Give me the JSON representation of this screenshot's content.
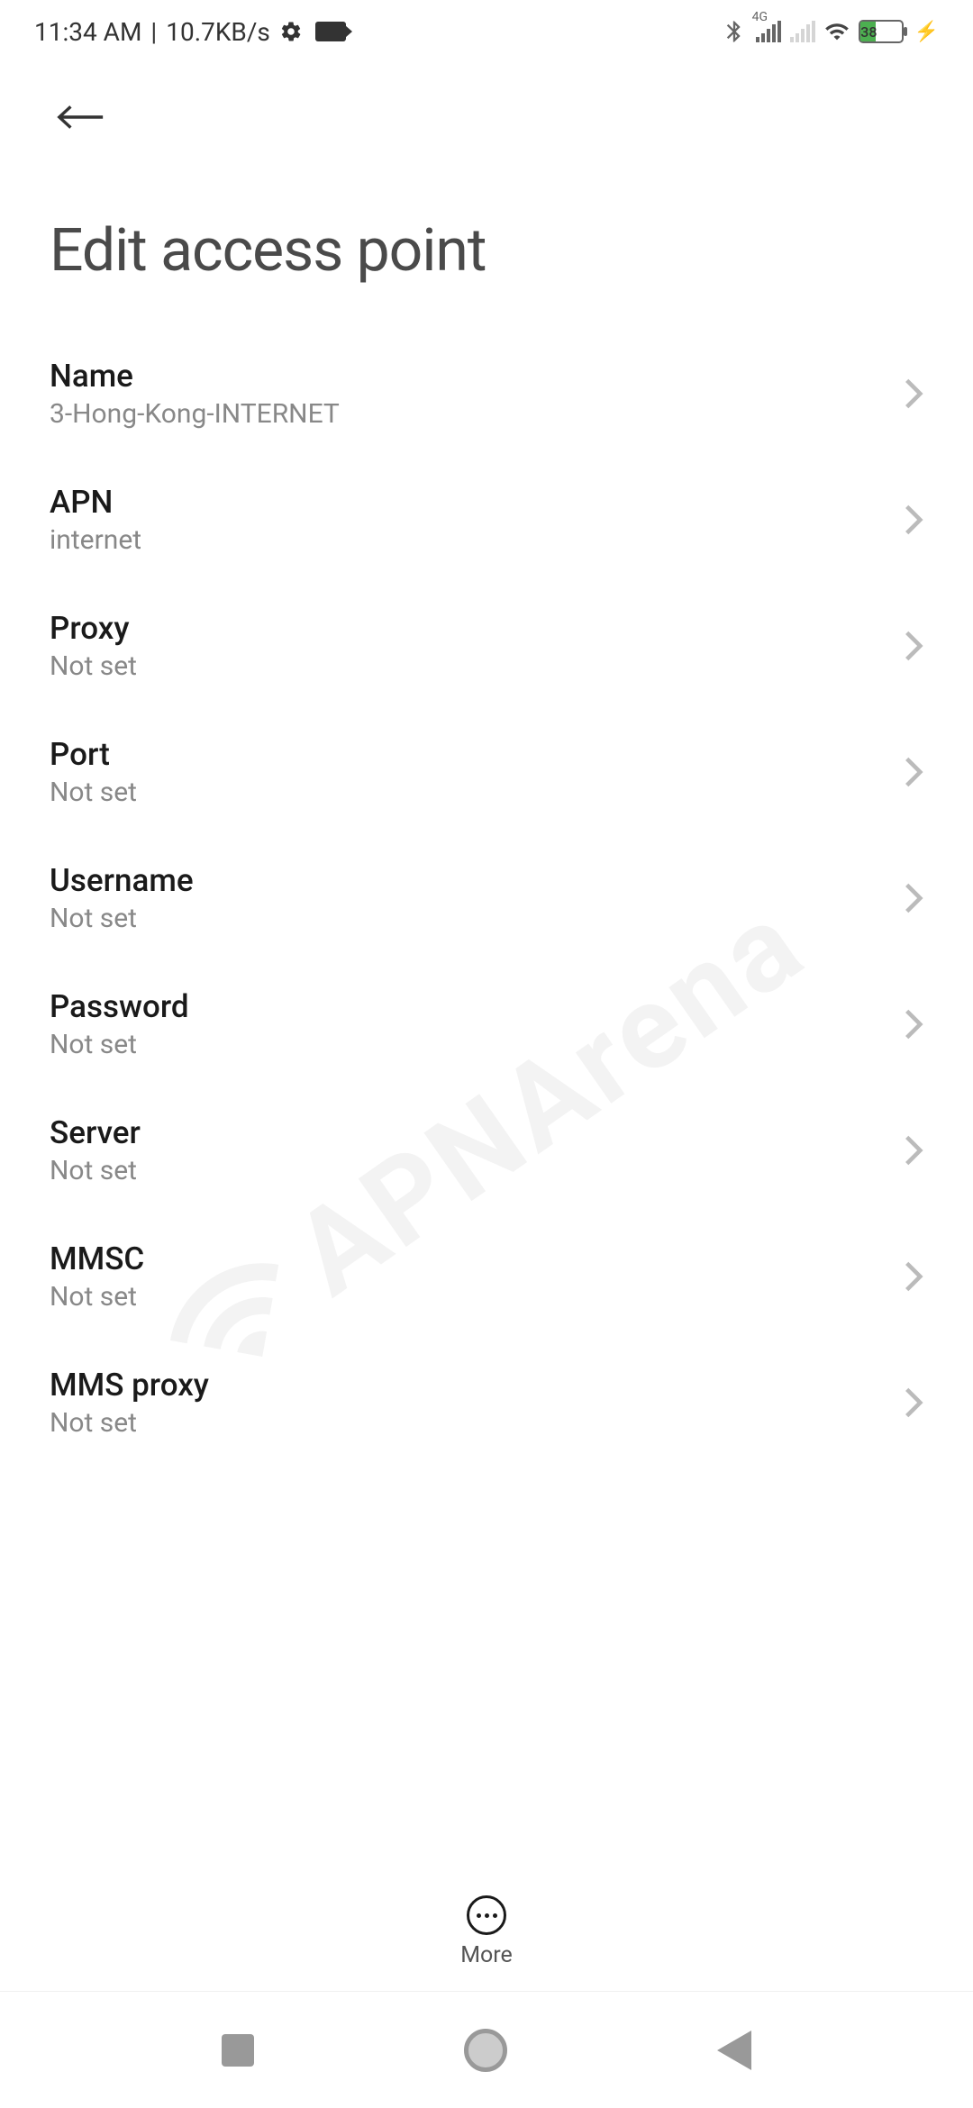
{
  "status": {
    "time": "11:34 AM",
    "data_speed": "10.7KB/s",
    "network_label": "4G",
    "battery_pct": "38"
  },
  "page_title": "Edit access point",
  "items": [
    {
      "label": "Name",
      "value": "3-Hong-Kong-INTERNET"
    },
    {
      "label": "APN",
      "value": "internet"
    },
    {
      "label": "Proxy",
      "value": "Not set"
    },
    {
      "label": "Port",
      "value": "Not set"
    },
    {
      "label": "Username",
      "value": "Not set"
    },
    {
      "label": "Password",
      "value": "Not set"
    },
    {
      "label": "Server",
      "value": "Not set"
    },
    {
      "label": "MMSC",
      "value": "Not set"
    },
    {
      "label": "MMS proxy",
      "value": "Not set"
    }
  ],
  "bottom": {
    "more": "More"
  },
  "watermark": "APNArena"
}
